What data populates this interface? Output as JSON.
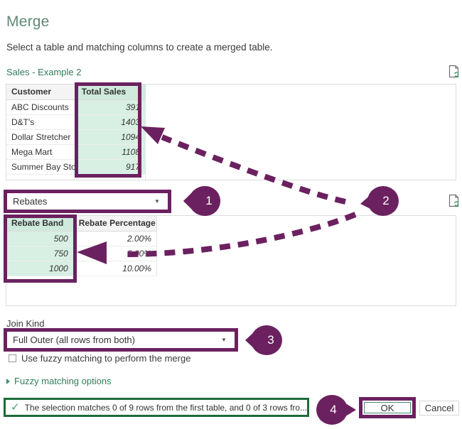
{
  "dialog": {
    "title": "Merge",
    "subtitle": "Select a table and matching columns to create a merged table."
  },
  "first_table": {
    "name": "Sales - Example 2",
    "columns": [
      "Customer",
      "Total Sales"
    ],
    "selected_column": "Total Sales",
    "rows": [
      {
        "customer": "ABC Discounts",
        "total_sales": "391"
      },
      {
        "customer": "D&T's",
        "total_sales": "1403"
      },
      {
        "customer": "Dollar Stretcher",
        "total_sales": "1094"
      },
      {
        "customer": "Mega Mart",
        "total_sales": "1108"
      },
      {
        "customer": "Summer Bay Store",
        "total_sales": "917"
      }
    ],
    "refresh_icon": "page-refresh-icon"
  },
  "second_table": {
    "selector_value": "Rebates",
    "selector_caret": "▼",
    "columns": [
      "Rebate Band",
      "Rebate Percentage"
    ],
    "selected_column": "Rebate Band",
    "rows": [
      {
        "band": "500",
        "percentage": "2.00%"
      },
      {
        "band": "750",
        "percentage": "5.00%"
      },
      {
        "band": "1000",
        "percentage": "10.00%"
      }
    ],
    "refresh_icon": "page-refresh-icon"
  },
  "join": {
    "label": "Join Kind",
    "value": "Full Outer (all rows from both)",
    "caret": "▼",
    "fuzzy_checkbox_label": "Use fuzzy matching to perform the merge",
    "fuzzy_checked": false,
    "fuzzy_options_label": "Fuzzy matching options",
    "fuzzy_options_expanded": false
  },
  "status": {
    "icon": "check-icon",
    "message": "The selection matches 0 of 9 rows from the first table, and 0 of 3 rows fro..."
  },
  "footer": {
    "ok_label": "OK",
    "cancel_label": "Cancel"
  },
  "annotations": {
    "badges": [
      {
        "number": "1",
        "points": "right-to-left"
      },
      {
        "number": "2",
        "points": "down-left"
      },
      {
        "number": "3",
        "points": "left"
      },
      {
        "number": "4",
        "points": "right"
      }
    ]
  },
  "colors": {
    "accent_purple": "#6b2160",
    "title_green": "#5e8b76",
    "link_green": "#2e7d5b",
    "status_green": "#1e6b3a",
    "selected_cell": "#d8efe3",
    "selected_header": "#cfeadd"
  }
}
